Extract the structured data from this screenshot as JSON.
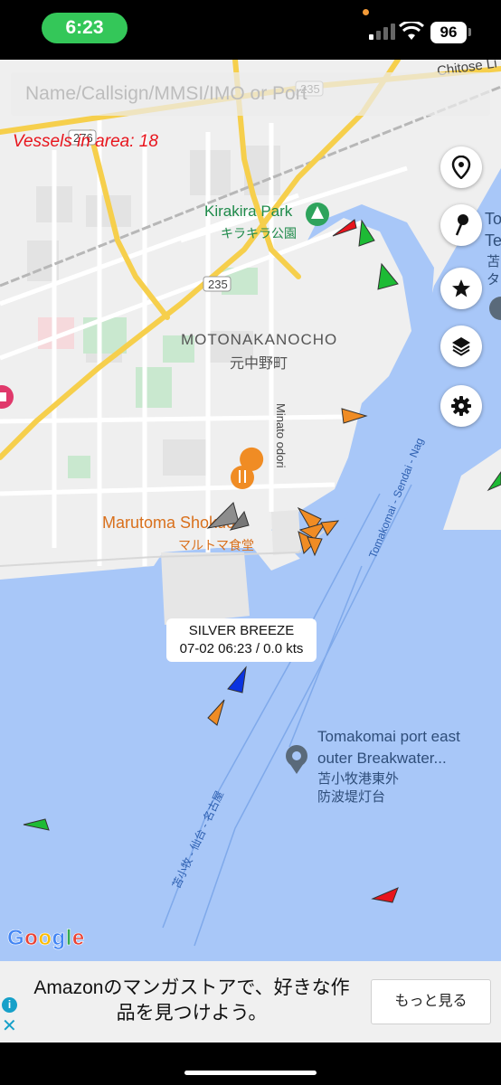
{
  "status_bar": {
    "time": "6:23",
    "battery": "96"
  },
  "search": {
    "placeholder": "Name/Callsign/MMSI/IMO or Port"
  },
  "vessel_count": "Vessels in area: 18",
  "map_labels": {
    "chitose": "Chitose Li",
    "road_235_top": "235",
    "road_276": "276",
    "road_235_mid": "235",
    "kirakira_park": "Kirakira Park",
    "kirakira_park_jp": "キラキラ公園",
    "motonakanocho": "MOTONAKANOCHO",
    "motonakanocho_jp": "元中野町",
    "minato_odori": "Minato odori",
    "marutoma": "Marutoma Shokudo",
    "marutoma_jp": "マルトマ食堂",
    "tomakomai_sendai_nagoya": "Tomakomai - Sendai - Nag",
    "tomakomai_jp_route": "苫小牧 - 仙台 - 名古屋",
    "breakwater_line1": "Tomakomai port east",
    "breakwater_line2": "outer Breakwater...",
    "breakwater_jp1": "苫小牧港東外",
    "breakwater_jp2": "防波堤灯台",
    "edge_to": "To",
    "edge_te": "Te",
    "edge_jp1": "苫",
    "edge_jp2": "タ"
  },
  "popup": {
    "vessel_name": "SILVER BREEZE",
    "vessel_info": "07-02 06:23 / 0.0 kts"
  },
  "fab_buttons": [
    {
      "icon": "location-pin-icon"
    },
    {
      "icon": "drop-pin-icon"
    },
    {
      "icon": "star-icon"
    },
    {
      "icon": "layers-icon"
    },
    {
      "icon": "gear-icon"
    }
  ],
  "google_logo": "Google",
  "ad": {
    "text": "Amazonのマンガストアで、好きな作品を見つけよう。",
    "button": "もっと見る",
    "close": "✕",
    "info": "i"
  },
  "colors": {
    "water": "#a8c7f8",
    "land": "#efefef",
    "vessel_cargo_green": "#1dbb35",
    "vessel_tanker_red": "#e8141c",
    "vessel_passenger_blue": "#0a33e0",
    "vessel_other_orange": "#f08c24",
    "vessel_unknown_gray": "#8d8d8d",
    "count_text": "#e8141c"
  }
}
